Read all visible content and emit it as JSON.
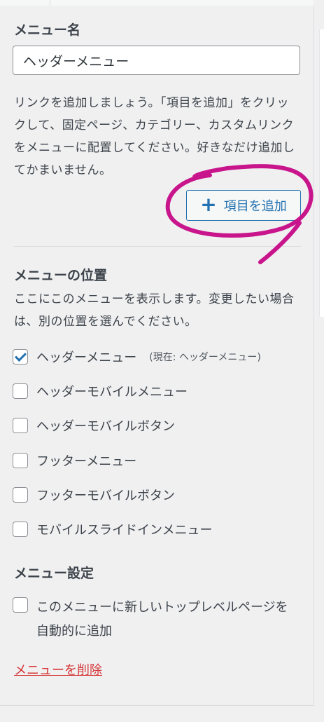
{
  "menu_name": {
    "label": "メニュー名",
    "value": "ヘッダーメニュー"
  },
  "help_text": "リンクを追加しましょう。「項目を追加」をクリックして、固定ページ、カテゴリー、カスタムリンクをメニューに配置してください。好きなだけ追加してかまいません。",
  "add_items_button": {
    "icon": "plus-icon",
    "label": "項目を追加"
  },
  "menu_location": {
    "heading": "メニューの位置",
    "description": "ここにこのメニューを表示します。変更したい場合は、別の位置を選んでください。",
    "locations": [
      {
        "label": "ヘッダーメニュー",
        "checked": true,
        "note": "(現在: ヘッダーメニュー)"
      },
      {
        "label": "ヘッダーモバイルメニュー",
        "checked": false
      },
      {
        "label": "ヘッダーモバイルボタン",
        "checked": false
      },
      {
        "label": "フッターメニュー",
        "checked": false
      },
      {
        "label": "フッターモバイルボタン",
        "checked": false
      },
      {
        "label": "モバイルスライドインメニュー",
        "checked": false
      }
    ]
  },
  "menu_settings": {
    "heading": "メニュー設定",
    "auto_add_label": "このメニューに新しいトップレベルページを自動的に追加",
    "auto_add_checked": false
  },
  "delete_link": "メニューを削除",
  "colors": {
    "accent": "#2271b1",
    "delete": "#d63638",
    "annotation": "#c8158c",
    "panel_bg": "#f0f0f1"
  }
}
